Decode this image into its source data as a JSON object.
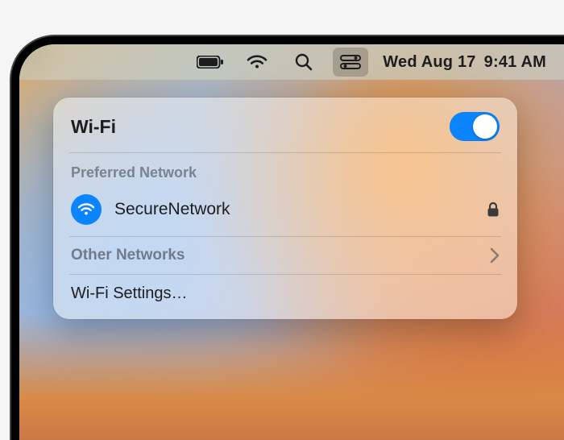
{
  "menubar": {
    "date": "Wed Aug 17",
    "time": "9:41 AM"
  },
  "panel": {
    "title": "Wi-Fi",
    "wifi_on": true,
    "preferred_label": "Preferred Network",
    "network": {
      "name": "SecureNetwork",
      "locked": true
    },
    "other_label": "Other Networks",
    "settings_label": "Wi-Fi Settings…"
  }
}
